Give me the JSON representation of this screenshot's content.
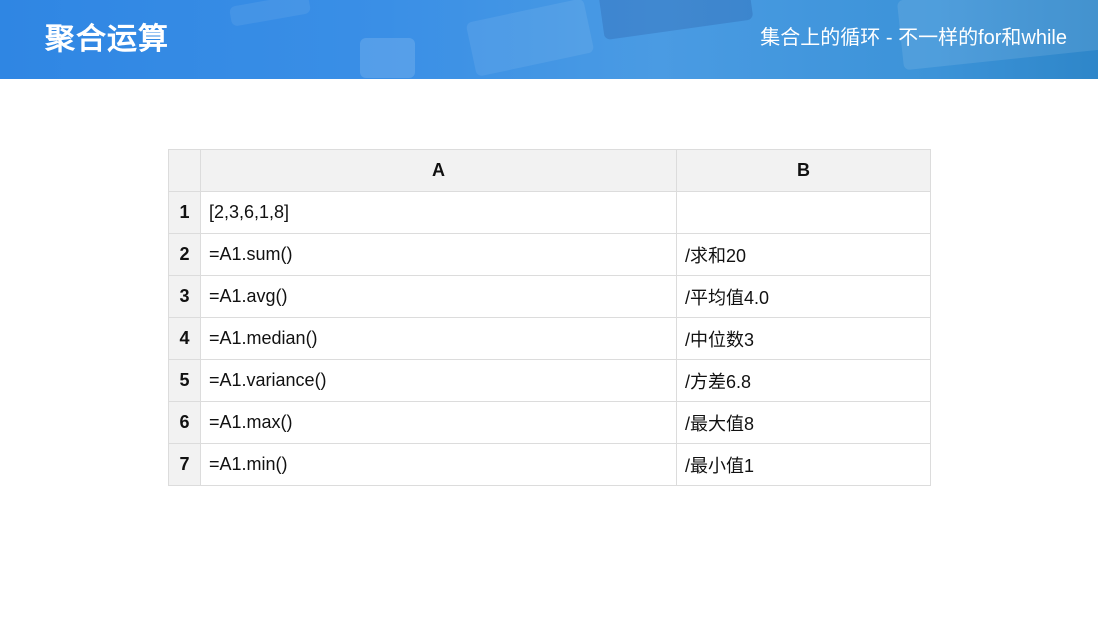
{
  "header": {
    "title": "聚合运算",
    "subtitle": "集合上的循环 - 不一样的for和while",
    "gradient_start": "#2f86e3",
    "gradient_end": "#2e86c9"
  },
  "sheet": {
    "columns": [
      "A",
      "B"
    ],
    "rows": [
      {
        "num": "1",
        "a": "[2,3,6,1,8]",
        "b": ""
      },
      {
        "num": "2",
        "a": "=A1.sum()",
        "b": "/求和20"
      },
      {
        "num": "3",
        "a": "=A1.avg()",
        "b": "/平均值4.0"
      },
      {
        "num": "4",
        "a": "=A1.median()",
        "b": "/中位数3"
      },
      {
        "num": "5",
        "a": "=A1.variance()",
        "b": "/方差6.8"
      },
      {
        "num": "6",
        "a": "=A1.max()",
        "b": "/最大值8"
      },
      {
        "num": "7",
        "a": "=A1.min()",
        "b": "/最小值1"
      }
    ]
  }
}
